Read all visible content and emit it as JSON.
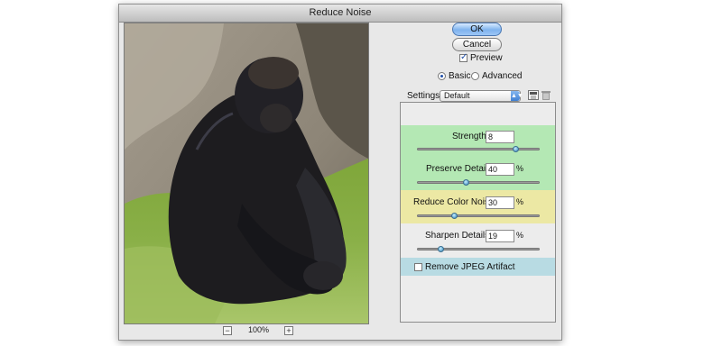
{
  "window": {
    "title": "Reduce Noise"
  },
  "preview": {
    "zoom_out": "−",
    "zoom_level": "100%",
    "zoom_in": "+"
  },
  "buttons": {
    "ok": "OK",
    "cancel": "Cancel"
  },
  "preview_toggle": {
    "label": "Preview",
    "checked": true
  },
  "mode": {
    "basic": "Basic",
    "advanced": "Advanced",
    "selected": "Basic"
  },
  "settings": {
    "label": "Settings:",
    "value": "Default"
  },
  "controls": {
    "strength": {
      "label": "Strength:",
      "value": "8",
      "unit": "",
      "slider_fraction": 0.8,
      "band_color": "#b4e8b4"
    },
    "preserve_details": {
      "label": "Preserve Details:",
      "value": "40",
      "unit": "%",
      "slider_fraction": 0.4,
      "band_color": "#b4e8b4"
    },
    "reduce_color_noise": {
      "label": "Reduce Color Noise:",
      "value": "30",
      "unit": "%",
      "slider_fraction": 0.3,
      "band_color": "#ece8a4"
    },
    "sharpen_details": {
      "label": "Sharpen Details:",
      "value": "19",
      "unit": "%",
      "slider_fraction": 0.19,
      "band_color": "#ececec"
    }
  },
  "jpeg_artifact": {
    "label": "Remove JPEG Artifact",
    "checked": false,
    "band_color": "#b8dbe3"
  },
  "colors": {
    "default_button": "#7fb3ee",
    "accent": "#1f4fa8"
  },
  "icons": {
    "save_settings": "save-disk-icon",
    "delete_settings": "trash-icon",
    "select_arrow": "up-down-arrow-icon"
  }
}
